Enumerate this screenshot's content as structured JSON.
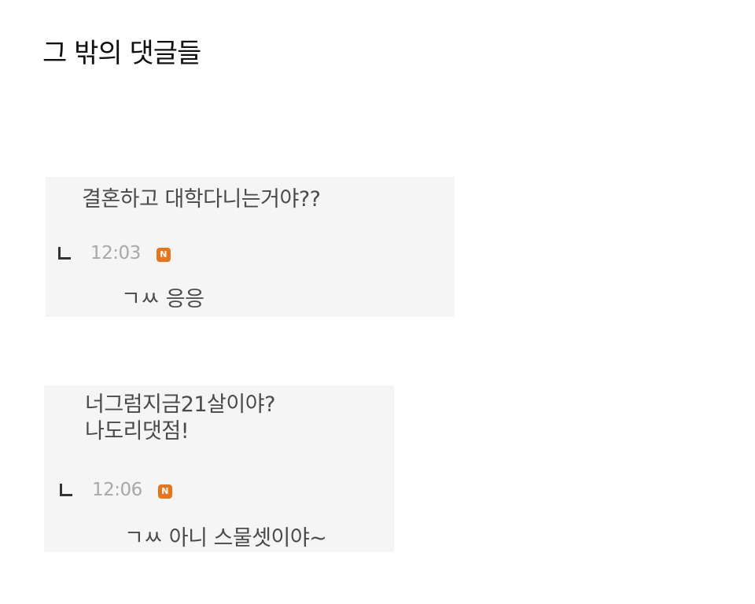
{
  "page_title": "그 밖의 댓글들",
  "comments": [
    {
      "text_lines": [
        "결혼하고 대학다니는거야??"
      ],
      "reply": {
        "time": "12:03",
        "badge": "N",
        "text": "ㄱㅆ 응응"
      }
    },
    {
      "text_lines": [
        "너그럼지금21살이야?",
        "나도리댓점!"
      ],
      "reply": {
        "time": "12:06",
        "badge": "N",
        "text": "ㄱㅆ 아니 스물셋이야~"
      }
    }
  ],
  "colors": {
    "box_background": "#f5f5f5",
    "badge": "#e8751a",
    "timestamp": "#a8a8a8"
  },
  "icons": {
    "reply_arrow": "reply-arrow-icon",
    "new_badge": "new-badge-icon"
  }
}
